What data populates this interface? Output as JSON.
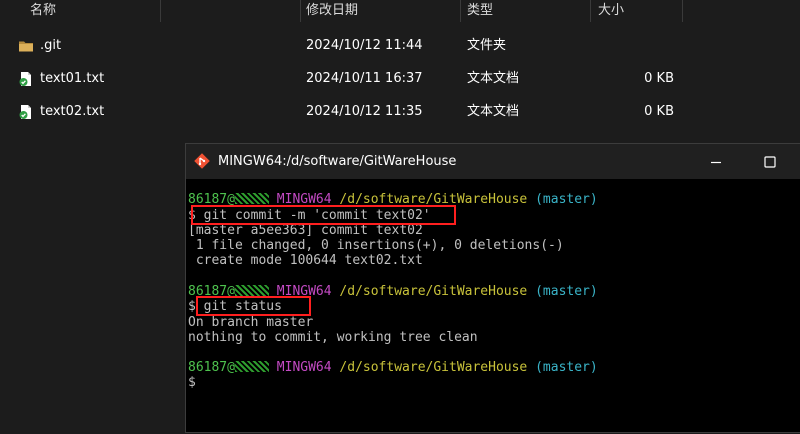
{
  "explorer": {
    "columns": {
      "name": "名称",
      "modified": "修改日期",
      "type": "类型",
      "size": "大小"
    },
    "files": [
      {
        "name": ".git",
        "modified": "2024/10/12 11:44",
        "type": "文件夹",
        "size": "",
        "icon": "folder-icon"
      },
      {
        "name": "text01.txt",
        "modified": "2024/10/11 16:37",
        "type": "文本文档",
        "size": "0 KB",
        "icon": "text-file-icon"
      },
      {
        "name": "text02.txt",
        "modified": "2024/10/12 11:35",
        "type": "文本文档",
        "size": "0 KB",
        "icon": "text-file-icon"
      }
    ]
  },
  "terminal": {
    "title": "MINGW64:/d/software/GitWareHouse",
    "prompt": {
      "user": "86187@",
      "env": "MINGW64",
      "path": "/d/software/GitWareHouse",
      "branch": "(master)"
    },
    "lines": {
      "cmd1": "$ git commit -m 'commit text02'",
      "out1": "[master a5ee363] commit text02",
      "out2": " 1 file changed, 0 insertions(+), 0 deletions(-)",
      "out3": " create mode 100644 text02.txt",
      "cmd2": "$ git status",
      "out4": "On branch master",
      "out5": "nothing to commit, working tree clean",
      "cmd3": "$"
    }
  },
  "colors": {
    "highlight": "#ff1f1f",
    "prompt_user": "#4ec24e",
    "prompt_env": "#c34ac3",
    "prompt_path": "#c8c23a",
    "prompt_branch": "#3ab4c8"
  }
}
